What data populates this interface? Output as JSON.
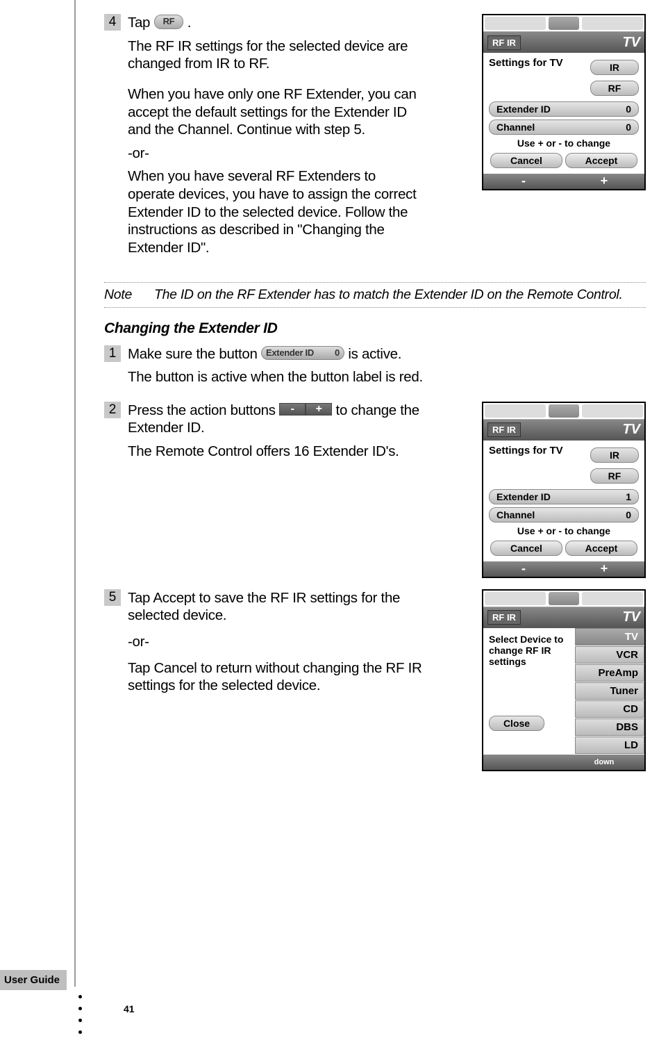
{
  "steps": {
    "s4": {
      "num": "4",
      "p1a": "Tap ",
      "pilltext": "RF",
      "p1b": " .",
      "p2": "The RF IR settings for the selected device are changed from IR to RF.",
      "p3": "When you have only one RF Extender, you can accept the default settings for the Extender ID and the Channel. Continue with step 5.",
      "or": "-or-",
      "p4": "When you have several RF Extenders to operate devices, you have to assign the correct Extender ID to the selected device. Follow the instructions as described in \"Changing the Extender ID\"."
    },
    "s1": {
      "num": "1",
      "p1a": "Make sure the button ",
      "pill_label": "Extender ID",
      "pill_val": "0",
      "p1b": " is active.",
      "p2": "The button is active when the button label is red."
    },
    "s2": {
      "num": "2",
      "p1a": "Press the action buttons ",
      "minus": "-",
      "plus": "+",
      "p1b": " to change the Extender ID.",
      "p2": "The Remote Control offers 16 Extender ID's."
    },
    "s5": {
      "num": "5",
      "p1": "Tap Accept to save the RF IR settings for the selected device.",
      "or": "-or-",
      "p2": "Tap Cancel to return without changing the RF IR settings for the selected device."
    }
  },
  "note": {
    "label": "Note",
    "text": "The ID on the RF Extender has to match the Extender ID on the Remote Control."
  },
  "subhead": "Changing the Extender ID",
  "shot_common": {
    "ribbon_tab": "RF IR",
    "ribbon_right": "TV",
    "settings_for": "Settings for TV",
    "ir": "IR",
    "rf": "RF",
    "extid": "Extender ID",
    "channel": "Channel",
    "hint": "Use + or - to change",
    "cancel": "Cancel",
    "accept": "Accept",
    "minus": "-",
    "plus": "+"
  },
  "shot1": {
    "extid_val": "0",
    "channel_val": "0"
  },
  "shot2": {
    "extid_val": "1",
    "channel_val": "0"
  },
  "shot3": {
    "prompt": "Select Device to change RF IR settings",
    "items": [
      "TV",
      "TV",
      "VCR",
      "PreAmp",
      "Tuner",
      "CD",
      "DBS",
      "LD"
    ],
    "close": "Close",
    "down": "down"
  },
  "footer": {
    "tag": "User Guide",
    "page": "41"
  }
}
